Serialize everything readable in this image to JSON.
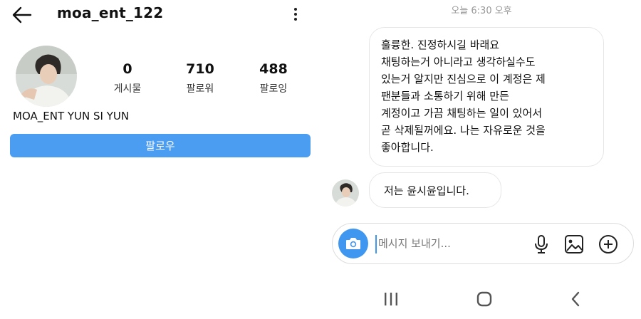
{
  "profile": {
    "username": "moa_ent_122",
    "display_name": "MOA_ENT YUN SI YUN",
    "stats": [
      {
        "value": "0",
        "label": "게시물"
      },
      {
        "value": "710",
        "label": "팔로워"
      },
      {
        "value": "488",
        "label": "팔로잉"
      }
    ],
    "follow_label": "팔로우"
  },
  "chat": {
    "timestamp": "오늘 6:30 오후",
    "messages": [
      {
        "lines": [
          "훌륭한. 진정하시길 바래요",
          "채팅하는거 아니라고 생각하실수도",
          "있는거 알지만 진심으로 이 계정은 제",
          "팬분들과 소통하기 위해 만든",
          "계정이고 가끔 채팅하는 일이 있어서",
          "곧 삭제될꺼에요. 나는 자유로운 것을",
          "좋아합니다."
        ]
      },
      {
        "text": "저는 윤시윤입니다."
      }
    ],
    "composer": {
      "placeholder": "메시지 보내기...",
      "value": ""
    }
  },
  "colors": {
    "accent": "#4a9df0",
    "camera": "#3f97ef",
    "border": "#e6e6e6"
  },
  "icons": [
    "back-arrow-icon",
    "more-vertical-icon",
    "camera-icon",
    "microphone-icon",
    "image-icon",
    "add-circle-icon",
    "recent-apps-icon",
    "home-icon",
    "nav-back-icon"
  ]
}
